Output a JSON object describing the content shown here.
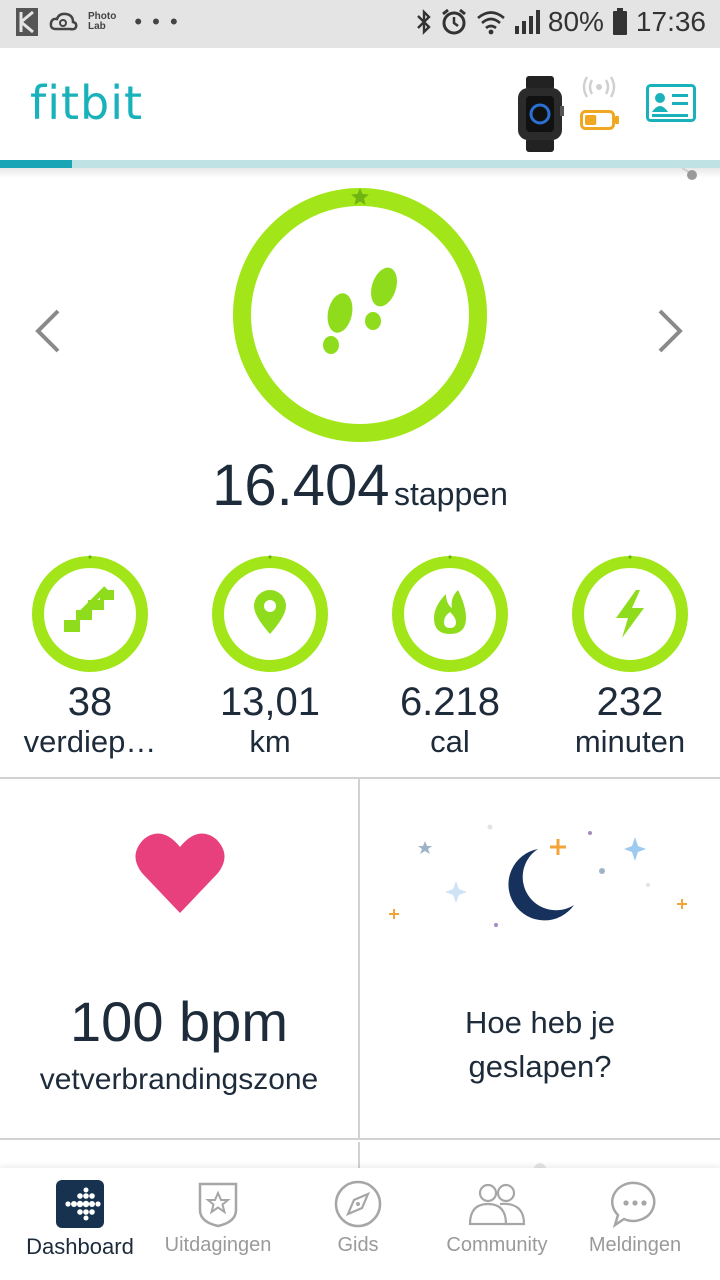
{
  "status_bar": {
    "app_label_line1": "Photo",
    "app_label_line2": "Lab",
    "overflow": "• • •",
    "battery_percent": "80%",
    "time": "17:36"
  },
  "header": {
    "logo": "fitbit",
    "device_battery_level": 0.45
  },
  "page_indicator": {
    "progress": 0.1
  },
  "steps": {
    "value": "16.404",
    "unit": "stappen",
    "goal_progress": 1.0,
    "ring_color": "#a2e619",
    "icon_color": "#8fdc1c"
  },
  "stats": [
    {
      "value": "38",
      "unit": "verdiep…",
      "icon": "stairs-icon"
    },
    {
      "value": "13,01",
      "unit": "km",
      "icon": "location-pin-icon"
    },
    {
      "value": "6.218",
      "unit": "cal",
      "icon": "flame-icon"
    },
    {
      "value": "232",
      "unit": "minuten",
      "icon": "lightning-icon"
    }
  ],
  "tiles": {
    "heart_rate": {
      "value": "100 bpm",
      "zone": "vetverbrandingszone",
      "icon_color": "#e8407c"
    },
    "sleep": {
      "question_line1": "Hoe heb je",
      "question_line2": "geslapen?",
      "moon_color": "#16315c"
    }
  },
  "nav": [
    {
      "label": "Dashboard",
      "icon": "dashboard-icon",
      "active": true
    },
    {
      "label": "Uitdagingen",
      "icon": "star-badge-icon",
      "active": false
    },
    {
      "label": "Gids",
      "icon": "compass-icon",
      "active": false
    },
    {
      "label": "Community",
      "icon": "people-icon",
      "active": false
    },
    {
      "label": "Meldingen",
      "icon": "chat-bubble-icon",
      "active": false
    }
  ],
  "colors": {
    "accent": "#19b2bb",
    "ring_green": "#a2e619",
    "text_dark": "#1d2b3a",
    "nav_inactive": "#9a9a9a"
  }
}
